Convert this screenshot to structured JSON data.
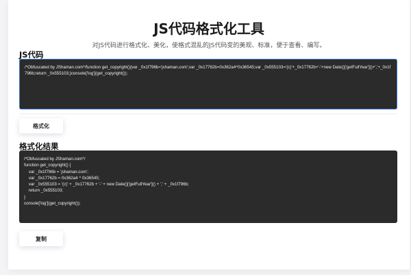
{
  "header": {
    "title": "JS代码格式化工具",
    "subtitle": "对JS代码进行格式化、美化，使格式混乱的JS代码变的美观、标准，便于查看、编写。"
  },
  "input": {
    "label": "JS代码",
    "value": "/*Obfuscated by JShaman.com*/function get_copyright(){var _0x1f796b='jshaman.com';var _0x17762b=0x362a4^0x36545;var _0x555103='(c)'+_0x17762b+'-'+new Date()['getFullYear']()+','+_0x1f796b;return _0x555103;}console['log'](get_copyright());"
  },
  "format_button": {
    "label": "格式化"
  },
  "output": {
    "label": "格式化结果",
    "value": "/*Obfuscated by JShaman.com*/\nfunction get_copyright() {\n    var _0x1f796b = 'jshaman.com';\n    var _0x17762b = 0x362a4 ^ 0x36545;\n    var _0x555103 = '(c)' + _0x17762b + '-' + new Date()['getFullYear']() + ',' + _0x1f796b;\n    return _0x555103;\n}\nconsole['log'](get_copyright());"
  },
  "copy_button": {
    "label": "复制"
  },
  "colors": {
    "code_background": "#2b2b2b",
    "focus_border": "#3c7bd9",
    "page_background": "#ffffff"
  }
}
